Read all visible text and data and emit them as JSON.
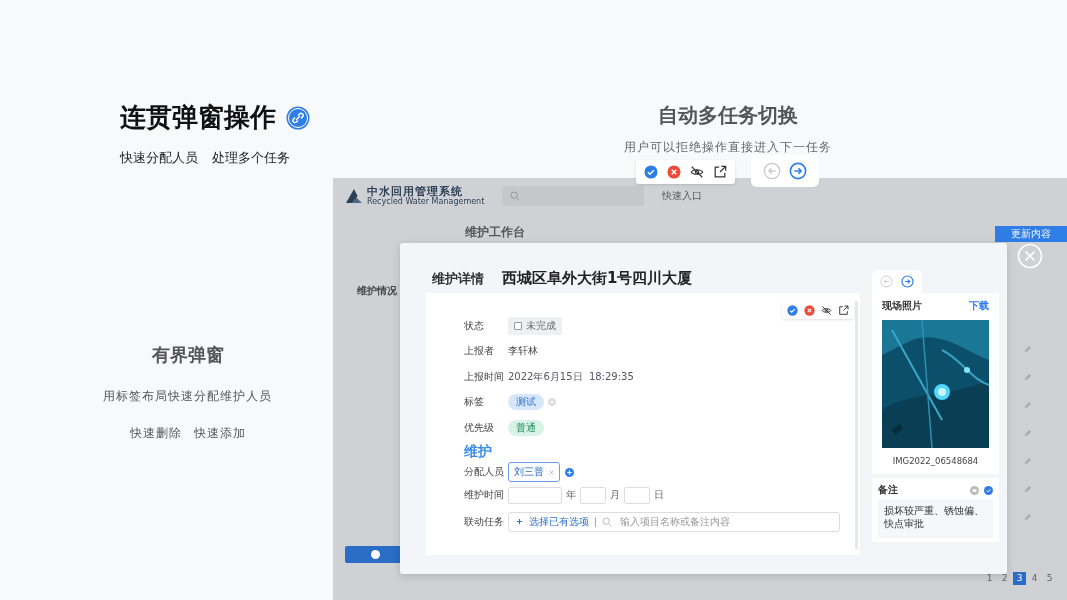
{
  "hero": {
    "title": "连贯弹窗操作",
    "subtitle": [
      "快速分配人员",
      "处理多个任务"
    ]
  },
  "feature_top": {
    "title": "自动多任务切换",
    "description": "用户可以拒绝操作直接进入下一任务"
  },
  "feature_left": {
    "title": "有界弹窗",
    "description": "用标签布局快速分配维护人员",
    "actions": [
      "快速删除",
      "快速添加"
    ]
  },
  "app": {
    "logo_title": "中水回用管理系统",
    "logo_subtitle": "Recycled Water Management",
    "quick_entry": "快速入口",
    "page_title": "维护工作台",
    "update_button": "更新内容",
    "nav": [
      {
        "label": "维护情况",
        "selected": true
      }
    ],
    "pagination": [
      {
        "label": "1",
        "selected": false
      },
      {
        "label": "2",
        "selected": false
      },
      {
        "label": "3",
        "selected": true
      },
      {
        "label": "4",
        "selected": false
      },
      {
        "label": "5",
        "selected": false
      }
    ]
  },
  "modal": {
    "heading": "维护详情",
    "title": "西城区阜外大街1号四川大厦",
    "status": {
      "label": "状态",
      "value": "未完成",
      "checked": false
    },
    "reporter": {
      "label": "上报者",
      "value": "李轩林"
    },
    "report_time": {
      "label": "上报时间",
      "value": "2022年6月15日  18:29:35"
    },
    "tags": {
      "label": "标签",
      "items": [
        "测试"
      ]
    },
    "priority": {
      "label": "优先级",
      "value": "普通"
    },
    "section": "维护",
    "assignee": {
      "label": "分配人员",
      "items": [
        "刘三普"
      ]
    },
    "date": {
      "label": "维护时间",
      "units": [
        "年",
        "月",
        "日"
      ]
    },
    "linked": {
      "label": "联动任务",
      "action": "选择已有选项",
      "placeholder": "输入项目名称或备注内容"
    },
    "photo": {
      "title": "现场照片",
      "download": "下载",
      "filename": "IMG2022_06548684"
    },
    "note": {
      "title": "备注",
      "text": "损坏较严重、锈蚀偏、快点审批"
    }
  }
}
